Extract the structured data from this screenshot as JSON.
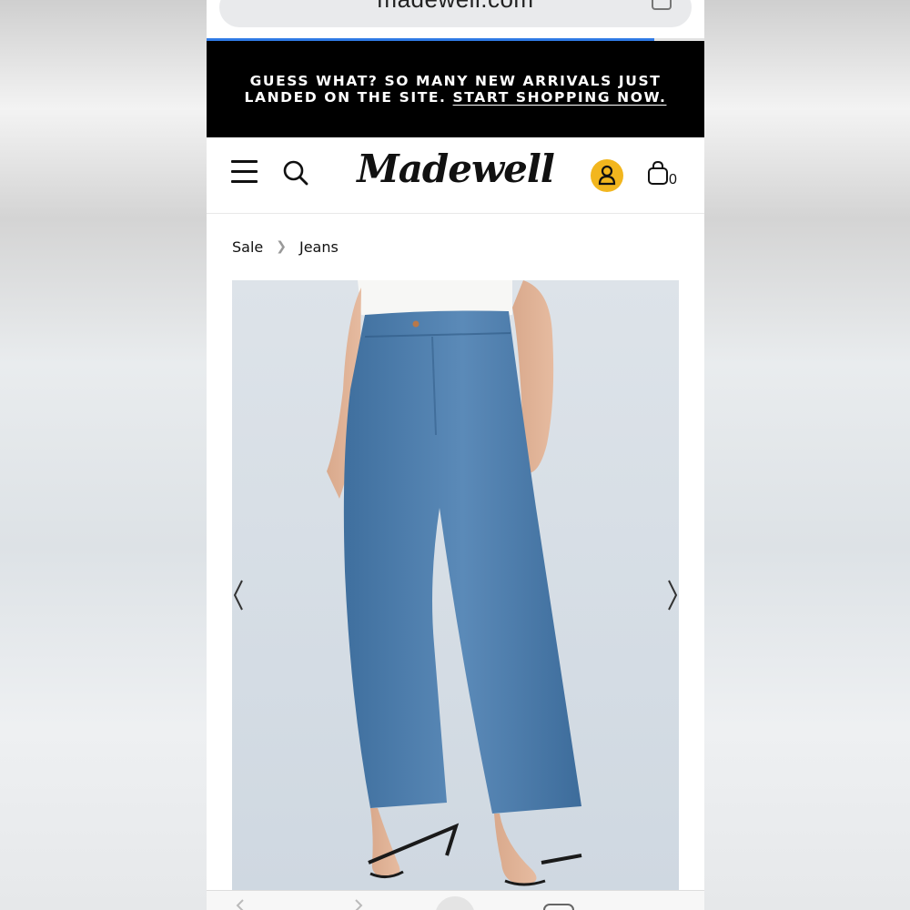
{
  "browser": {
    "url": "madewell.com",
    "share_icon": "share-icon",
    "load_progress": 0.9
  },
  "banner": {
    "line1": "GUESS WHAT? SO MANY NEW ARRIVALS JUST",
    "line2_text": "LANDED ON THE SITE.",
    "line2_link": "START SHOPPING NOW."
  },
  "header": {
    "menu_icon": "hamburger-menu-icon",
    "search_icon": "search-icon",
    "logo": "Madewell",
    "account_icon": "account-icon",
    "bag_icon": "shopping-bag-icon",
    "bag_count": "0",
    "accent_color": "#f2b61e"
  },
  "breadcrumb": {
    "items": [
      "Sale",
      "Jeans"
    ]
  },
  "product": {
    "image": "product-photo-wide-leg-jeans",
    "prev_icon": "chevron-left-icon",
    "next_icon": "chevron-right-icon"
  },
  "toolbar": {
    "icons": [
      "back-icon",
      "forward-icon",
      "new-tab-icon",
      "tabs-icon"
    ]
  }
}
